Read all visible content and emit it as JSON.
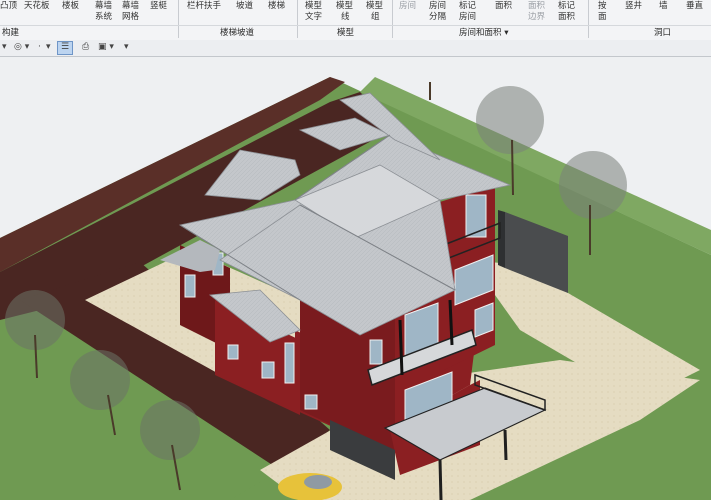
{
  "ribbon": {
    "buttons_row1": [
      {
        "id": "rb-1",
        "label": "凸顶"
      },
      {
        "id": "rb-2",
        "label": "天花板"
      },
      {
        "id": "rb-3",
        "label": "楼板"
      },
      {
        "id": "rb-4",
        "label": "幕墙"
      },
      {
        "id": "rb-5",
        "label": "幕墙"
      },
      {
        "id": "rb-6",
        "label": "竖梃"
      },
      {
        "id": "rb-7",
        "label": "栏杆扶手"
      },
      {
        "id": "rb-8",
        "label": "坡道"
      },
      {
        "id": "rb-9",
        "label": "楼梯"
      },
      {
        "id": "rb-10",
        "label": "模型"
      },
      {
        "id": "rb-11",
        "label": "模型"
      },
      {
        "id": "rb-12",
        "label": "模型"
      },
      {
        "id": "rb-13",
        "label": "房间"
      },
      {
        "id": "rb-14",
        "label": "房间"
      },
      {
        "id": "rb-15",
        "label": "标记"
      },
      {
        "id": "rb-16",
        "label": "面积"
      },
      {
        "id": "rb-17",
        "label": "面积"
      },
      {
        "id": "rb-18",
        "label": "标记"
      },
      {
        "id": "rb-19",
        "label": "按"
      },
      {
        "id": "rb-20",
        "label": "竖井"
      },
      {
        "id": "rb-21",
        "label": "墙"
      },
      {
        "id": "rb-22",
        "label": "垂直"
      }
    ],
    "buttons_row2": [
      {
        "id": "rb2-4",
        "label": "系统"
      },
      {
        "id": "rb2-5",
        "label": "网格"
      },
      {
        "id": "rb2-10",
        "label": "文字"
      },
      {
        "id": "rb2-11",
        "label": "线"
      },
      {
        "id": "rb2-12",
        "label": "组"
      },
      {
        "id": "rb2-14",
        "label": "分隔"
      },
      {
        "id": "rb2-15",
        "label": "房间"
      },
      {
        "id": "rb2-17",
        "label": "边界"
      },
      {
        "id": "rb2-18",
        "label": "面积"
      },
      {
        "id": "rb2-19",
        "label": "面"
      }
    ],
    "groups": {
      "build": "构建",
      "circulation": "楼梯坡道",
      "model": "模型",
      "room_area": "房间和面积 ▾",
      "opening": "洞口"
    }
  },
  "toolbar": {
    "items": [
      "◎ ▾",
      "·",
      "▾",
      "☰",
      "⎙",
      "▣ ▾",
      "▾"
    ]
  },
  "scene": {
    "colors": {
      "grass": "#6f9a52",
      "grass_dark": "#5c8544",
      "dirt": "#5a2f28",
      "paving": "#e5dcc2",
      "wall_red": "#8b1f22",
      "wall_red_dark": "#6e181a",
      "roof": "#c4c7cb",
      "roof_dark": "#9ea2a7",
      "glass": "#9fb6c6",
      "car": "#e7c23a"
    }
  }
}
